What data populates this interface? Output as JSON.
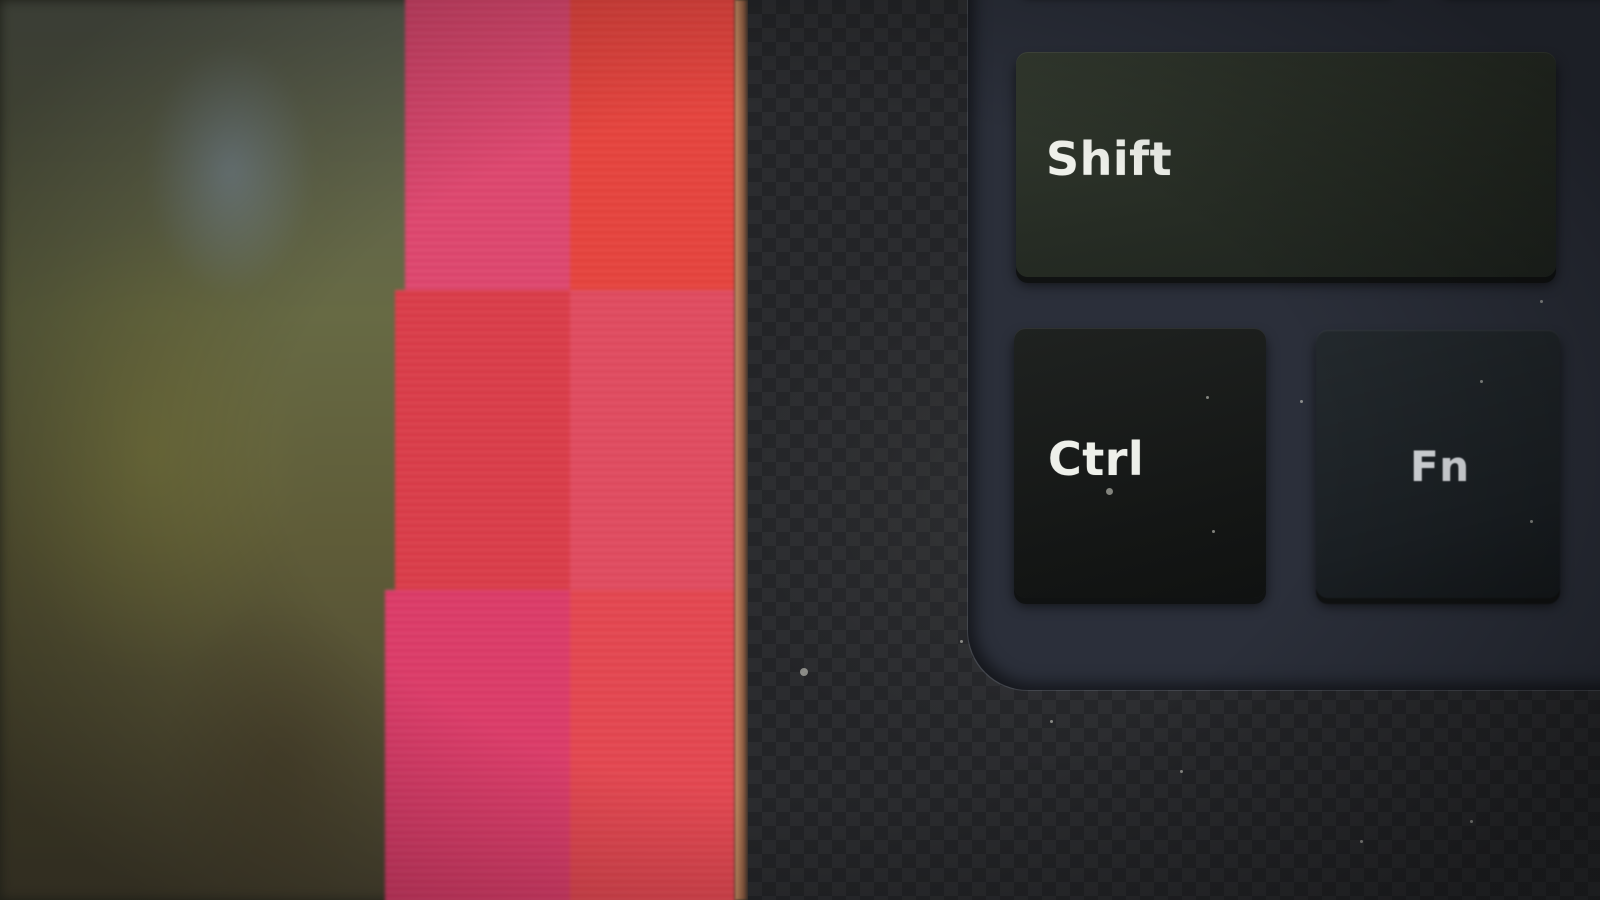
{
  "photo": {
    "keys": {
      "shift": {
        "label": "Shift"
      },
      "ctrl": {
        "label": "Ctrl"
      },
      "fn": {
        "label": "Fn"
      }
    }
  }
}
